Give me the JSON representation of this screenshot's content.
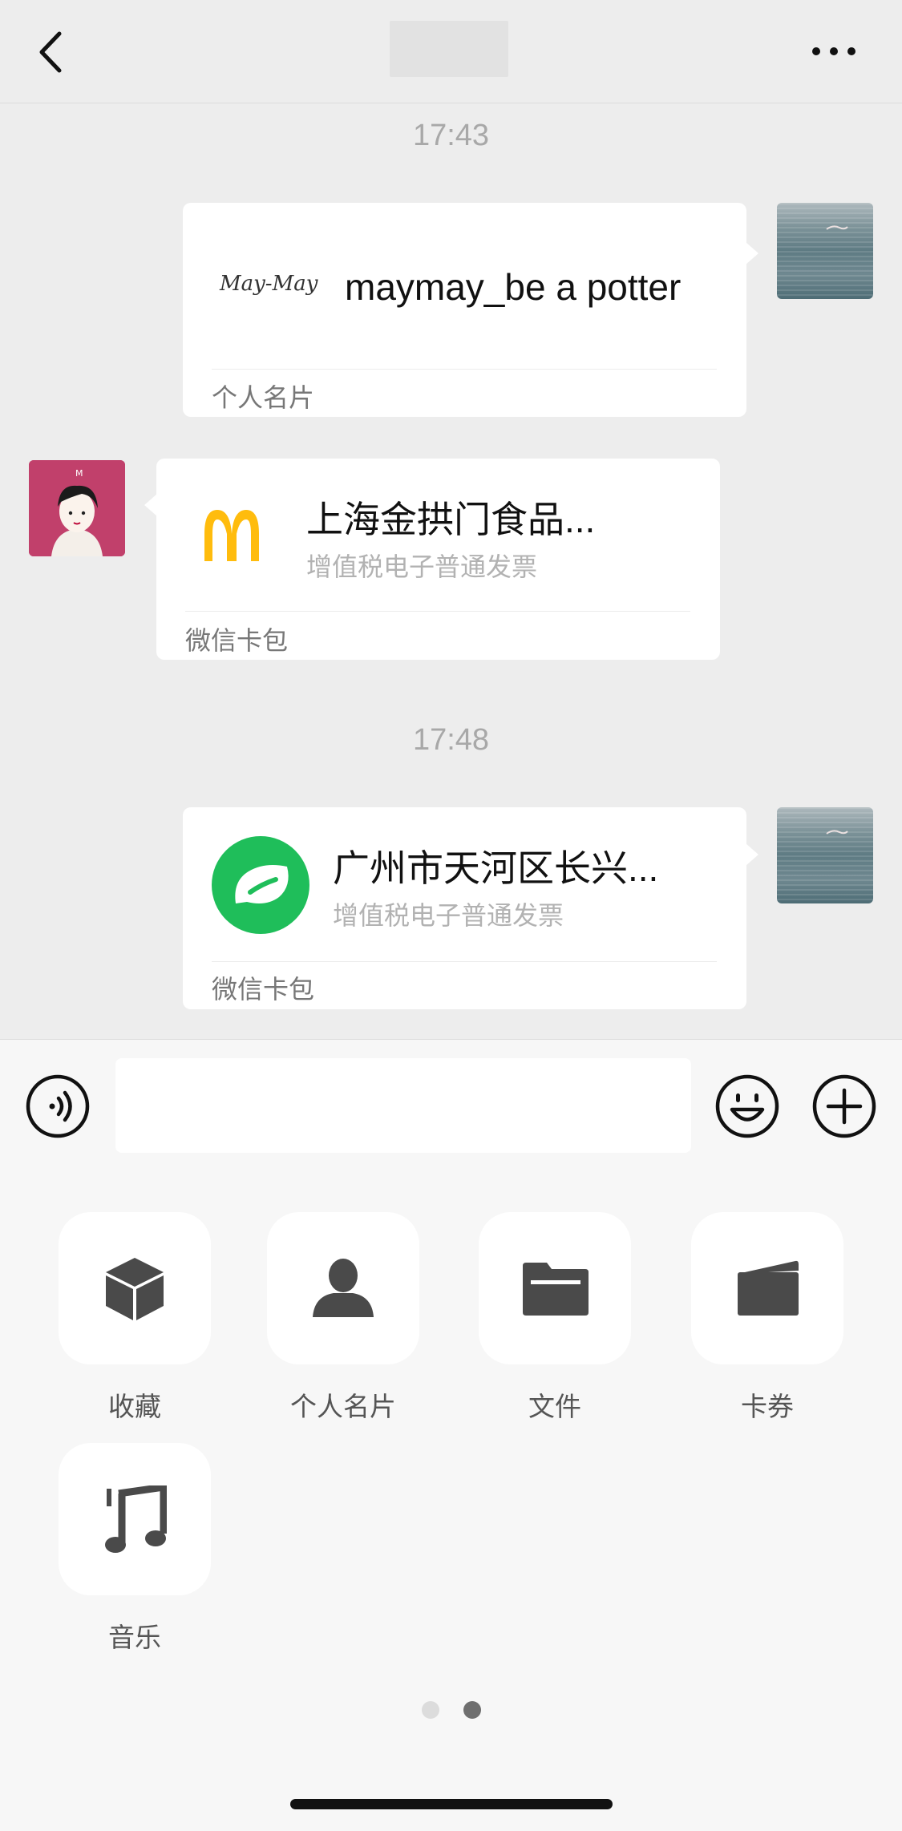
{
  "header": {
    "back_icon": "chevron-left-icon",
    "more_icon": "more-dots-icon"
  },
  "timestamps": [
    "17:43",
    "17:48"
  ],
  "messages": [
    {
      "side": "right",
      "type": "contact-card",
      "logo_text": "May-May",
      "title": "maymay_be a potter",
      "footer": "个人名片"
    },
    {
      "side": "left",
      "type": "wallet-card",
      "logo": "mcdonalds-logo",
      "title": "上海金拱门食品...",
      "subtitle": "增值税电子普通发票",
      "footer": "微信卡包"
    },
    {
      "side": "right",
      "type": "wallet-card",
      "logo": "green-leaf-logo",
      "title": "广州市天河区长兴...",
      "subtitle": "增值税电子普通发票",
      "footer": "微信卡包"
    }
  ],
  "input_bar": {
    "voice_icon": "voice-icon",
    "emoji_icon": "emoji-icon",
    "plus_icon": "plus-circle-icon",
    "text_value": ""
  },
  "panel": {
    "items": [
      {
        "label": "收藏",
        "icon": "cube-icon"
      },
      {
        "label": "个人名片",
        "icon": "person-icon"
      },
      {
        "label": "文件",
        "icon": "folder-icon"
      },
      {
        "label": "卡券",
        "icon": "wallet-icon"
      },
      {
        "label": "音乐",
        "icon": "music-note-icon"
      }
    ],
    "page_indicator": {
      "pages": 2,
      "current": 2
    }
  },
  "colors": {
    "background": "#ededed",
    "bubble": "#ffffff",
    "mcdonalds_yellow": "#ffbc0d",
    "green_brand": "#1fbe5a",
    "avatar_pink": "#c1406b"
  }
}
